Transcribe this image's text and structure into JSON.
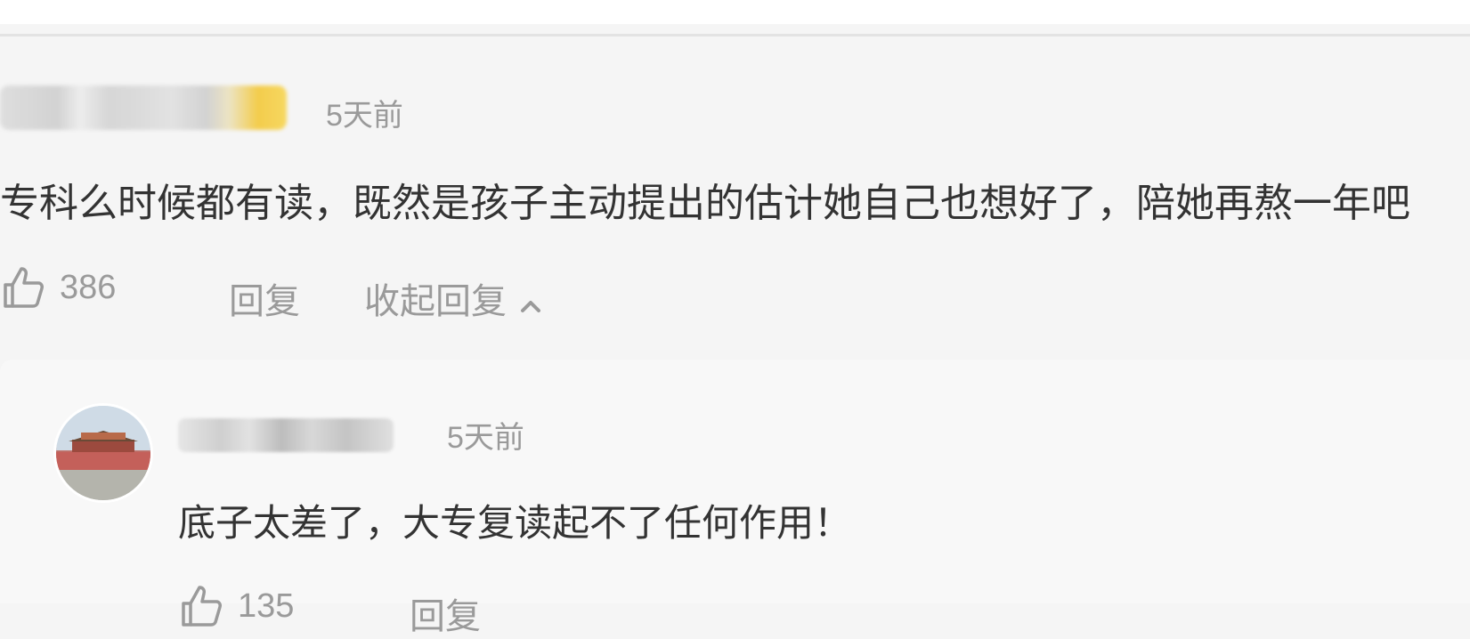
{
  "comment": {
    "time": "5天前",
    "text": "专科么时候都有读，既然是孩子主动提出的估计她自己也想好了，陪她再熬一年吧",
    "likes": "386",
    "reply_label": "回复",
    "collapse_label": "收起回复"
  },
  "reply": {
    "time": "5天前",
    "text": "底子太差了，大专复读起不了任何作用！",
    "likes": "135",
    "reply_label": "回复"
  },
  "colors": {
    "background": "#f5f5f5",
    "reply_background": "#f8f8f8",
    "muted_text": "#9a9a9a",
    "body_text": "#333333"
  },
  "icons": [
    "thumbs-up-icon",
    "chevron-up-icon"
  ]
}
